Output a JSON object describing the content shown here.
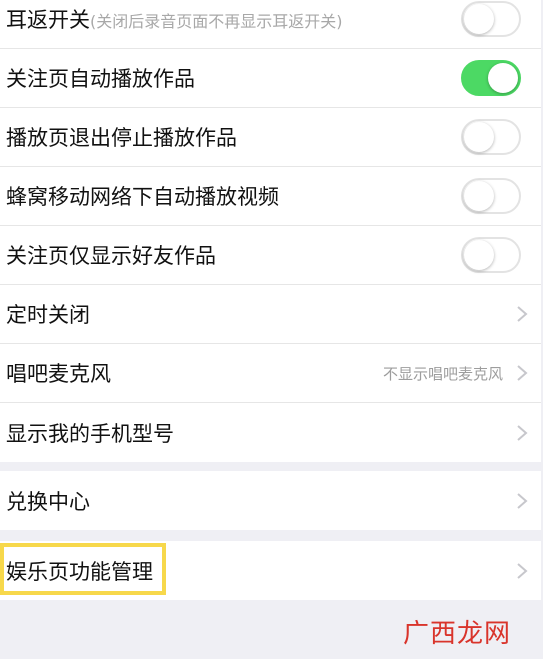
{
  "settings": {
    "group1": [
      {
        "label": "耳返开关",
        "note": "(关闭后录音页面不再显示耳返开关)",
        "type": "toggle",
        "on": false
      },
      {
        "label": "关注页自动播放作品",
        "type": "toggle",
        "on": true
      },
      {
        "label": "播放页退出停止播放作品",
        "type": "toggle",
        "on": false
      },
      {
        "label": "蜂窝移动网络下自动播放视频",
        "type": "toggle",
        "on": false
      },
      {
        "label": "关注页仅显示好友作品",
        "type": "toggle",
        "on": false
      },
      {
        "label": "定时关闭",
        "type": "link"
      },
      {
        "label": "唱吧麦克风",
        "value": "不显示唱吧麦克风",
        "type": "link"
      },
      {
        "label": "显示我的手机型号",
        "type": "link"
      }
    ],
    "group2": [
      {
        "label": "兑换中心",
        "type": "link"
      }
    ],
    "group3": [
      {
        "label": "娱乐页功能管理",
        "type": "link"
      }
    ]
  },
  "colors": {
    "toggle_on": "#4cd964",
    "highlight": "#f7d84b",
    "watermark": "#d9342b"
  },
  "watermark": "广西龙网"
}
